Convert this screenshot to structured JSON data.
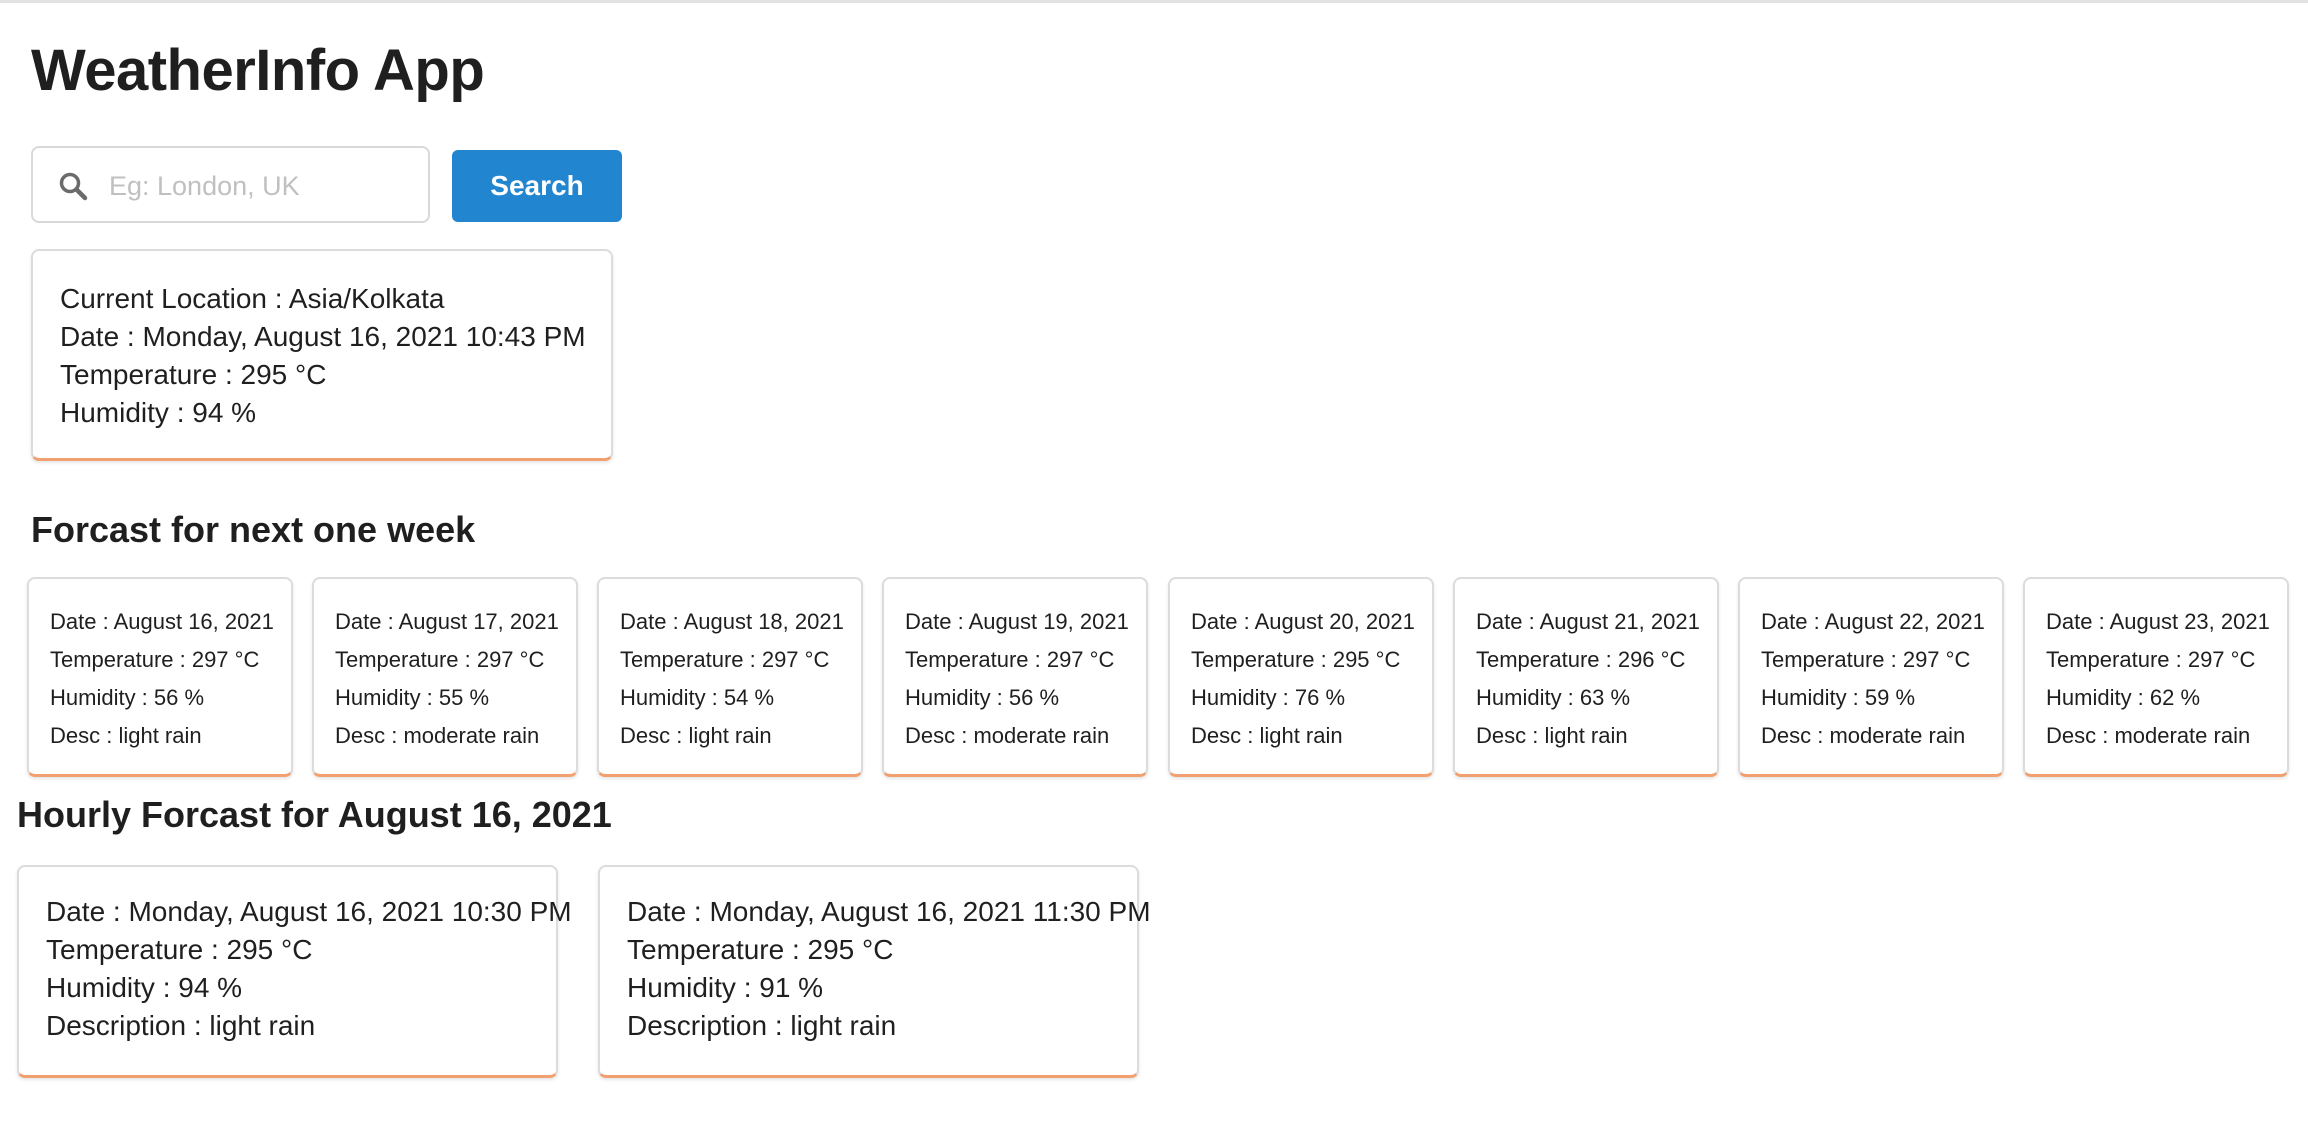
{
  "app": {
    "title": "WeatherInfo App"
  },
  "search": {
    "placeholder": "Eg: London, UK",
    "value": "",
    "button_label": "Search",
    "icon": "search-icon"
  },
  "colors": {
    "accent": "#2185d0",
    "card_bottom_border": "#f2a070"
  },
  "current": {
    "location": "Current Location : Asia/Kolkata",
    "date": "Date : Monday, August 16, 2021 10:43 PM",
    "temperature": "Temperature : 295 °C",
    "humidity": "Humidity : 94 %"
  },
  "week": {
    "title": "Forcast for next one week",
    "days": [
      {
        "date": "Date : August 16, 2021",
        "temperature": "Temperature : 297 °C",
        "humidity": "Humidity : 56 %",
        "desc": "Desc : light rain"
      },
      {
        "date": "Date : August 17, 2021",
        "temperature": "Temperature : 297 °C",
        "humidity": "Humidity : 55 %",
        "desc": "Desc : moderate rain"
      },
      {
        "date": "Date : August 18, 2021",
        "temperature": "Temperature : 297 °C",
        "humidity": "Humidity : 54 %",
        "desc": "Desc : light rain"
      },
      {
        "date": "Date : August 19, 2021",
        "temperature": "Temperature : 297 °C",
        "humidity": "Humidity : 56 %",
        "desc": "Desc : moderate rain"
      },
      {
        "date": "Date : August 20, 2021",
        "temperature": "Temperature : 295 °C",
        "humidity": "Humidity : 76 %",
        "desc": "Desc : light rain"
      },
      {
        "date": "Date : August 21, 2021",
        "temperature": "Temperature : 296 °C",
        "humidity": "Humidity : 63 %",
        "desc": "Desc : light rain"
      },
      {
        "date": "Date : August 22, 2021",
        "temperature": "Temperature : 297 °C",
        "humidity": "Humidity : 59 %",
        "desc": "Desc : moderate rain"
      },
      {
        "date": "Date : August 23, 2021",
        "temperature": "Temperature : 297 °C",
        "humidity": "Humidity : 62 %",
        "desc": "Desc : moderate rain"
      }
    ]
  },
  "hourly": {
    "title": "Hourly Forcast for August 16, 2021",
    "items": [
      {
        "date": "Date : Monday, August 16, 2021 10:30 PM",
        "temperature": "Temperature : 295 °C",
        "humidity": "Humidity : 94 %",
        "description": "Description : light rain"
      },
      {
        "date": "Date : Monday, August 16, 2021 11:30 PM",
        "temperature": "Temperature : 295 °C",
        "humidity": "Humidity : 91 %",
        "description": "Description : light rain"
      }
    ]
  }
}
